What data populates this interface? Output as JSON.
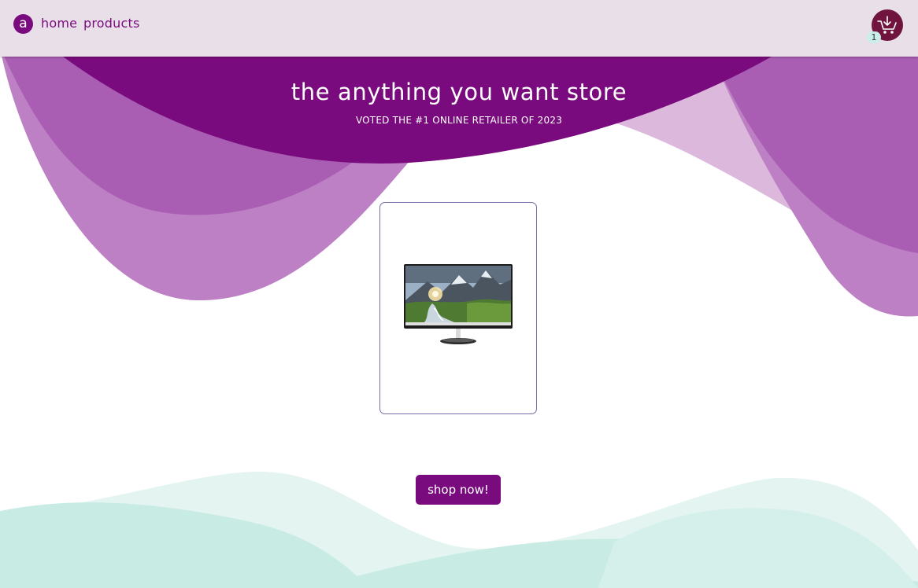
{
  "nav": {
    "logo_letter": "a",
    "home_label": "home",
    "products_label": "products",
    "cart_count": "1"
  },
  "hero": {
    "title": "the anything you want store",
    "subtitle": "VOTED THE #1 ONLINE RETAILER OF 2023"
  },
  "featured_product": {
    "image_icon": "monitor-icon"
  },
  "cta": {
    "label": "shop now!"
  },
  "colors": {
    "brand_purple": "#7a0b7e",
    "navbar_bg": "#e8dfe8",
    "cart_bg": "#70133d",
    "badge_bg": "#c9eee9",
    "wave_teal": "#c8ece4"
  }
}
